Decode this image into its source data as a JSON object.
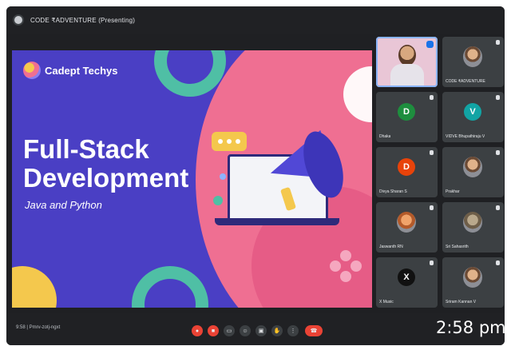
{
  "window": {
    "title": "CODE ₹ADVENTURE (Presenting)"
  },
  "slide": {
    "logo_text": "Cadept Techys",
    "heading_line1": "Full-Stack",
    "heading_line2": "Development",
    "subtitle": "Java and Python"
  },
  "participants": [
    {
      "name": "",
      "type": "video",
      "avatar": ""
    },
    {
      "name": "CODE ₹ADVENTURE",
      "type": "photo",
      "avatar": ""
    },
    {
      "name": "Dhaka",
      "type": "initial",
      "avatar": "D",
      "color": "#1e8e3e"
    },
    {
      "name": "VIDVE Bhupathiraju V",
      "type": "initial",
      "avatar": "V",
      "color": "#12a4a4"
    },
    {
      "name": "Divya Sharan S",
      "type": "initial",
      "avatar": "D",
      "color": "#e8430a"
    },
    {
      "name": "Prakhar",
      "type": "photo",
      "avatar": ""
    },
    {
      "name": "Jaswanth RN",
      "type": "photo",
      "avatar": ""
    },
    {
      "name": "Sri Sahasrith",
      "type": "photo",
      "avatar": ""
    },
    {
      "name": "X Music",
      "type": "photo",
      "avatar": "X"
    },
    {
      "name": "Sriram Kannan V",
      "type": "photo",
      "avatar": ""
    }
  ],
  "bottom_bar": {
    "meeting_info": "9:58  |  Pmrv-zotj-ngxt",
    "clock": "2:58 pm"
  },
  "colors": {
    "accent_red": "#ea4335",
    "slide_bg": "#4a3fc4",
    "pink": "#ef6f92",
    "teal": "#4fbfa5",
    "yellow": "#f4c84d"
  }
}
